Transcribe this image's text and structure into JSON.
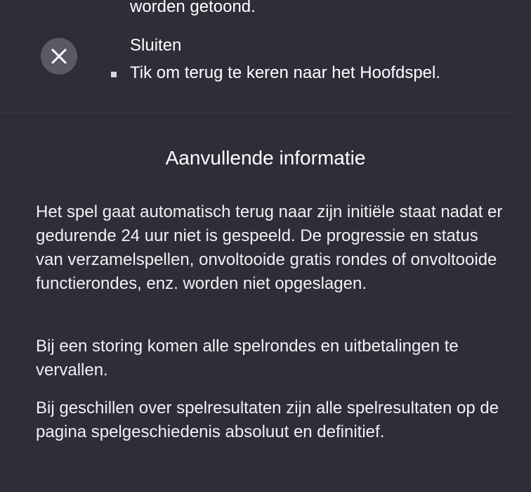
{
  "previous_item": {
    "text_tail": "worden getoond."
  },
  "close_item": {
    "icon": "close-icon",
    "title": "Sluiten",
    "description": "Tik om terug te keren naar het Hoofdspel."
  },
  "additional_info": {
    "heading": "Aanvullende informatie",
    "paragraphs": [
      "Het spel gaat automatisch terug naar zijn initiële staat nadat er gedurende 24 uur niet is gespeeld. De progressie en status van verzamelspellen, onvoltooide gratis rondes of onvoltooide functierondes, enz. worden niet opgeslagen.",
      "Bij een storing komen alle spelrondes en uitbetalingen te vervallen.",
      "Bij geschillen over spelresultaten zijn alle spelresultaten op de pagina spelgeschiedenis absoluut en definitief."
    ]
  },
  "colors": {
    "background": "#2e2d38",
    "icon_circle": "#5a5966",
    "text": "#ffffff"
  }
}
